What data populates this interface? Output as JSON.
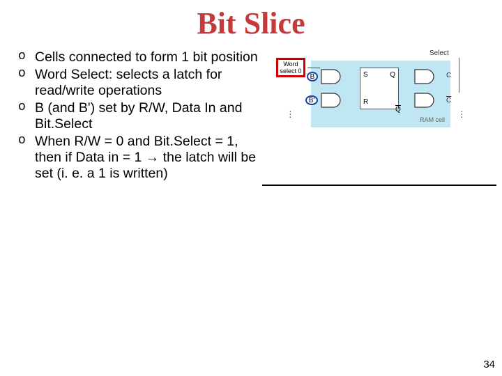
{
  "slide": {
    "title": "Bit Slice",
    "page_number": "34"
  },
  "bullets": [
    "Cells connected to form 1 bit position",
    "Word Select: selects a latch for read/write operations",
    "B (and B') set by R/W, Data In and Bit.Select",
    "When R/W = 0 and Bit.Select = 1, then if Data in = 1 → the latch will be set (i. e. a 1 is written)"
  ],
  "diagram": {
    "word_select_label": "Word select 0",
    "select_label": "Select",
    "ram_cell_label": "RAM cell",
    "b_label": "B",
    "bbar_label": "B'",
    "pin_s": "S",
    "pin_r": "R",
    "pin_q": "Q",
    "pin_qbar": "Q'",
    "out_c": "C",
    "out_cbar": "C'"
  }
}
